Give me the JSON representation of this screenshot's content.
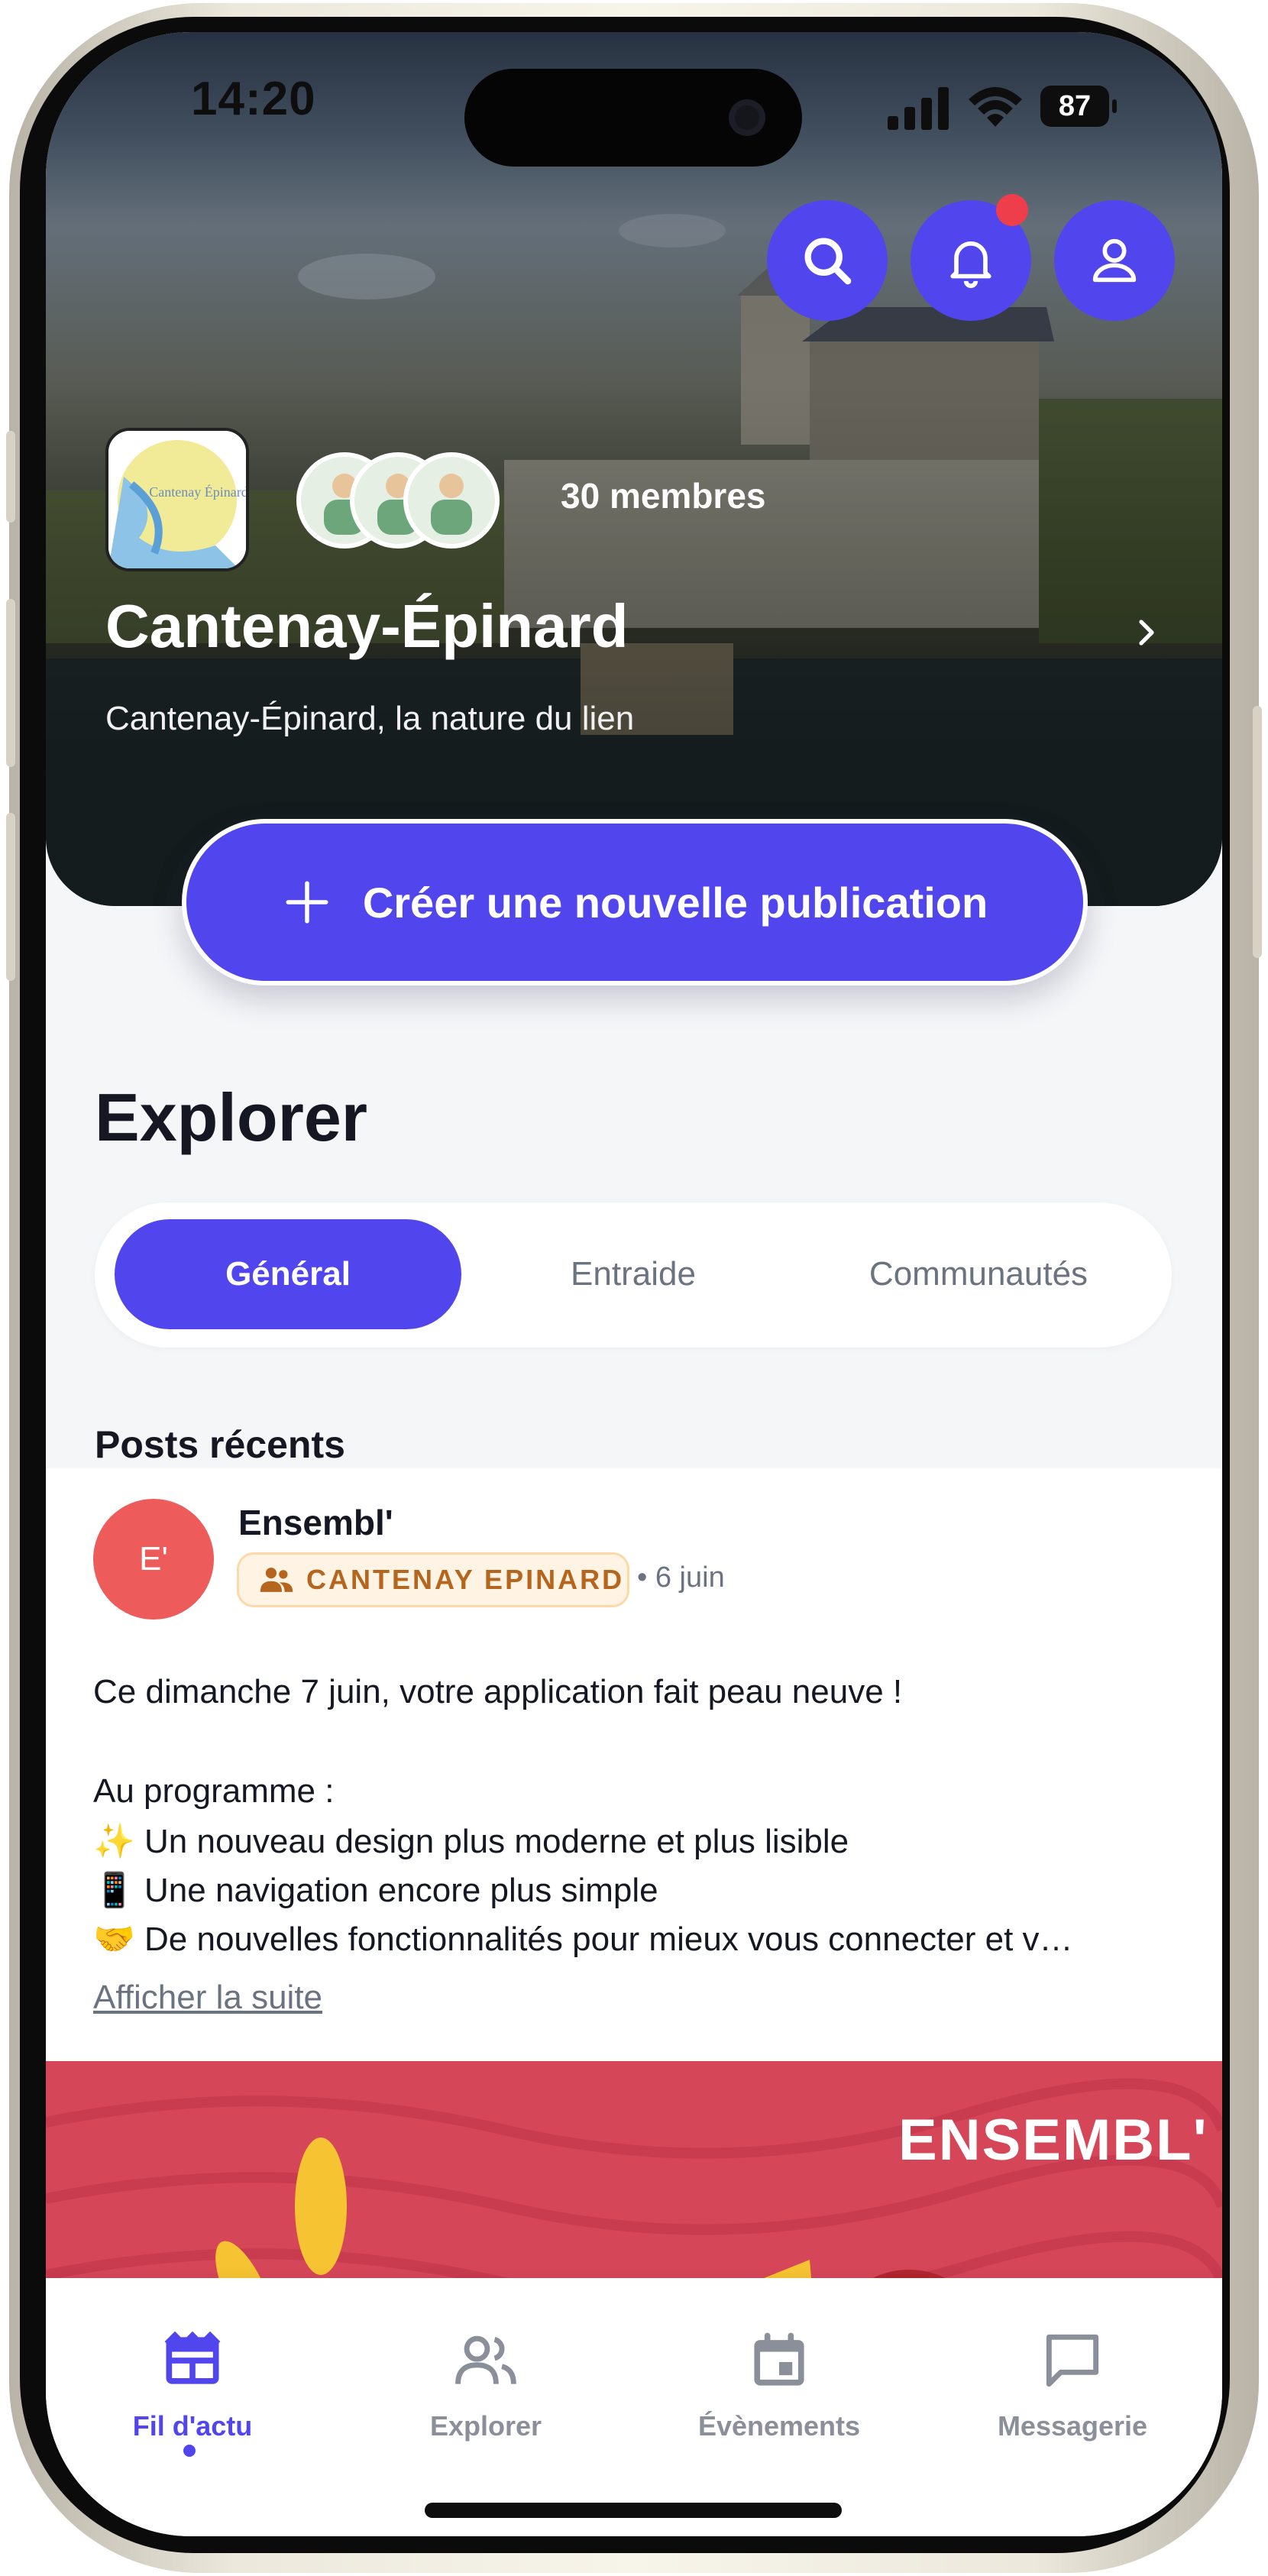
{
  "status_bar": {
    "time": "14:20",
    "battery": "87"
  },
  "header": {
    "community_name": "Cantenay-Épinard",
    "community_subtitle": "Cantenay-Épinard, la nature du lien",
    "members_label": "30 membres",
    "logo_text": "Cantenay Épinard",
    "notification_dot_color": "#ee3e4b"
  },
  "actions": {
    "create_post_label": "Créer une nouvelle publication"
  },
  "explore": {
    "title": "Explorer",
    "tabs": [
      "Général",
      "Entraide",
      "Communautés"
    ],
    "active_tab": "Général",
    "section_label": "Posts récents"
  },
  "post": {
    "avatar_initials": "E'",
    "author": "Ensembl'",
    "community_badge": "CANTENAY EPINARD",
    "date": "• 6 juin",
    "lines": [
      "Ce dimanche 7 juin, votre application fait peau neuve !",
      "",
      "Au programme :",
      "✨ Un nouveau design plus moderne et plus lisible",
      "📱 Une navigation encore plus simple",
      "🤝 De nouvelles fonctionnalités pour mieux vous connecter et v…"
    ],
    "show_more": "Afficher la suite",
    "banner_text": "ENSEMBL'"
  },
  "bottom_nav": {
    "items": [
      "Fil d'actu",
      "Explorer",
      "Évènements",
      "Messagerie"
    ],
    "active": "Fil d'actu"
  },
  "colors": {
    "accent": "#5146ee",
    "avatar": "#ee5b5b",
    "banner": "#d64659",
    "badge_text": "#b5651d"
  },
  "icons": [
    "search-icon",
    "bell-icon",
    "user-icon",
    "chevron-right-icon",
    "plus-icon",
    "group-icon",
    "newspaper-icon",
    "people-icon",
    "calendar-icon",
    "chat-icon"
  ]
}
